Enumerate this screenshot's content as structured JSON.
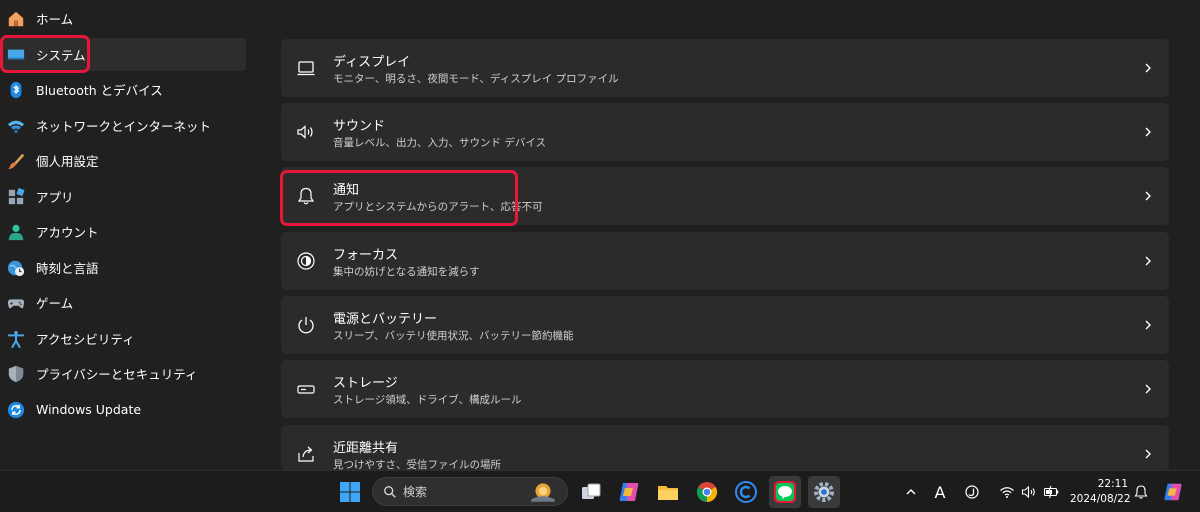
{
  "sidebar": {
    "items": [
      {
        "label": "ホーム",
        "icon": "home-icon"
      },
      {
        "label": "システム",
        "icon": "system-icon"
      },
      {
        "label": "Bluetooth とデバイス",
        "icon": "bluetooth-icon"
      },
      {
        "label": "ネットワークとインターネット",
        "icon": "wifi-icon"
      },
      {
        "label": "個人用設定",
        "icon": "brush-icon"
      },
      {
        "label": "アプリ",
        "icon": "apps-icon"
      },
      {
        "label": "アカウント",
        "icon": "account-icon"
      },
      {
        "label": "時刻と言語",
        "icon": "globe-clock-icon"
      },
      {
        "label": "ゲーム",
        "icon": "gamepad-icon"
      },
      {
        "label": "アクセシビリティ",
        "icon": "accessibility-icon"
      },
      {
        "label": "プライバシーとセキュリティ",
        "icon": "shield-icon"
      },
      {
        "label": "Windows Update",
        "icon": "update-icon"
      }
    ],
    "selected": "システム"
  },
  "main": {
    "cards": [
      {
        "title": "ディスプレイ",
        "subtitle": "モニター、明るさ、夜間モード、ディスプレイ プロファイル",
        "icon": "display-icon"
      },
      {
        "title": "サウンド",
        "subtitle": "音量レベル、出力、入力、サウンド デバイス",
        "icon": "speaker-icon"
      },
      {
        "title": "通知",
        "subtitle": "アプリとシステムからのアラート、応答不可",
        "icon": "bell-icon"
      },
      {
        "title": "フォーカス",
        "subtitle": "集中の妨げとなる通知を減らす",
        "icon": "focus-icon"
      },
      {
        "title": "電源とバッテリー",
        "subtitle": "スリープ、バッテリ使用状況、バッテリー節約機能",
        "icon": "power-icon"
      },
      {
        "title": "ストレージ",
        "subtitle": "ストレージ領域、ドライブ、構成ルール",
        "icon": "storage-icon"
      },
      {
        "title": "近距離共有",
        "subtitle": "見つけやすさ、受信ファイルの場所",
        "icon": "share-icon"
      }
    ]
  },
  "taskbar": {
    "search_placeholder": "検索",
    "ime": "A",
    "time": "22:11",
    "date": "2024/08/22",
    "apps": [
      "windows-start-icon",
      "task-view-icon",
      "copilot-icon",
      "file-explorer-icon",
      "chrome-icon",
      "c-app-icon",
      "line-icon",
      "settings-gear-icon"
    ]
  },
  "colors": {
    "background": "#202020",
    "card": "#2b2b2b",
    "highlight": "#e8173a",
    "accent": "#0078d4"
  }
}
